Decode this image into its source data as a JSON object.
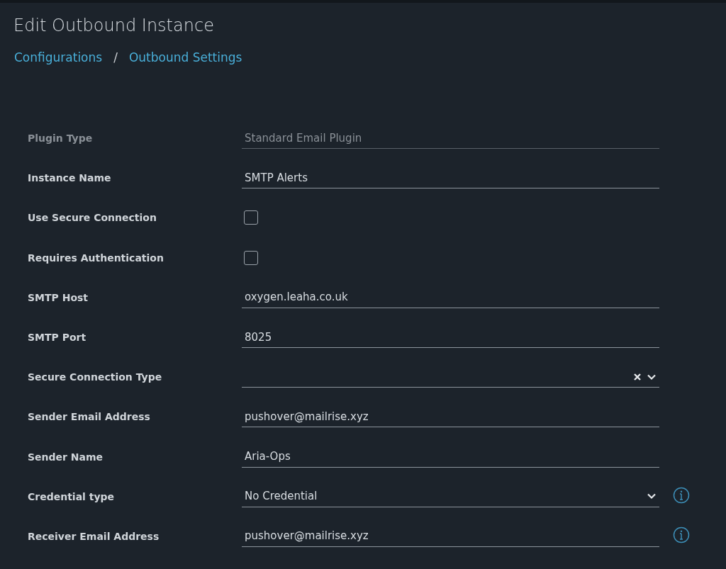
{
  "title": "Edit Outbound Instance",
  "breadcrumb": [
    "Configurations",
    "Outbound Settings"
  ],
  "breadcrumb_separator": "/",
  "fields": [
    {
      "label": "Plugin Type",
      "kind": "text",
      "value": "Standard Email Plugin",
      "disabled": true,
      "info": false
    },
    {
      "label": "Instance Name",
      "kind": "text",
      "value": "SMTP Alerts",
      "disabled": false,
      "info": false
    },
    {
      "label": "Use Secure Connection",
      "kind": "checkbox",
      "checked": false,
      "disabled": false,
      "info": false
    },
    {
      "label": "Requires Authentication",
      "kind": "checkbox",
      "checked": false,
      "disabled": false,
      "info": false
    },
    {
      "label": "SMTP Host",
      "kind": "text",
      "value": "oxygen.leaha.co.uk",
      "disabled": false,
      "info": false
    },
    {
      "label": "SMTP Port",
      "kind": "text",
      "value": "8025",
      "disabled": false,
      "info": false
    },
    {
      "label": "Secure Connection Type",
      "kind": "select",
      "clearable": true,
      "disabled": false,
      "info": false
    },
    {
      "label": "Sender Email Address",
      "kind": "text",
      "value": "pushover@mailrise.xyz",
      "disabled": false,
      "info": false
    },
    {
      "label": "Sender Name",
      "kind": "text",
      "value": "Aria-Ops",
      "disabled": false,
      "info": false
    },
    {
      "label": "Credential type",
      "kind": "select",
      "value": "No Credential",
      "clearable": false,
      "disabled": false,
      "info": true
    },
    {
      "label": "Receiver Email Address",
      "kind": "text",
      "value": "pushover@mailrise.xyz",
      "disabled": false,
      "info": true
    }
  ]
}
